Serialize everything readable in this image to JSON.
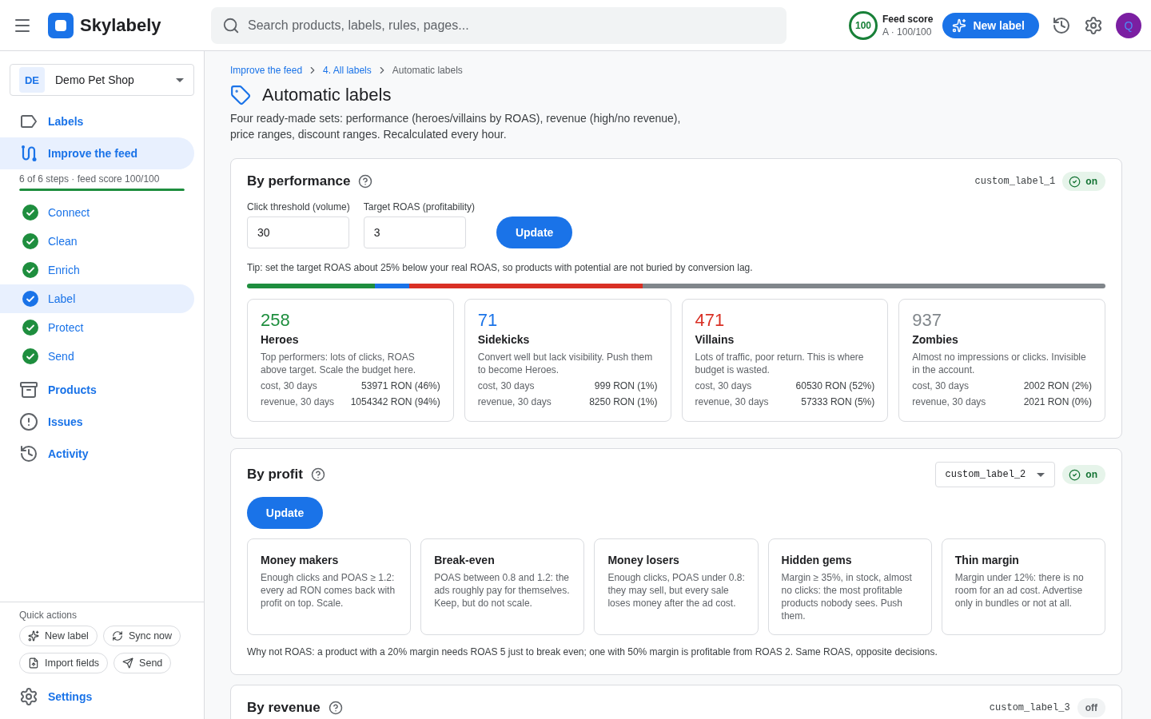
{
  "topbar": {
    "app_name": "Skylabely",
    "search": {
      "placeholder": "Search products, labels, rules, pages..."
    },
    "feed_score": {
      "value": "100",
      "title": "Feed score",
      "subtitle": "A · 100/100"
    },
    "new_label_button": "New label",
    "avatar": "Q"
  },
  "sidebar": {
    "account": {
      "initials": "DE",
      "name": "Demo Pet Shop"
    },
    "nav": [
      {
        "label": "Labels",
        "selected": false
      },
      {
        "label": "Improve the feed",
        "selected": true,
        "progress": {
          "text": "6 of 6 steps · feed score 100/100",
          "level": 1
        },
        "children": [
          {
            "label": "Connect",
            "done": true,
            "selected": false
          },
          {
            "label": "Clean",
            "done": true,
            "selected": false
          },
          {
            "label": "Enrich",
            "done": true,
            "selected": false
          },
          {
            "label": "Label",
            "done": true,
            "selected": true
          },
          {
            "label": "Protect",
            "done": true,
            "selected": false
          },
          {
            "label": "Send",
            "done": true,
            "selected": false
          }
        ]
      },
      {
        "label": "Products",
        "selected": false
      },
      {
        "label": "Issues",
        "selected": false
      },
      {
        "label": "Activity",
        "selected": false
      }
    ],
    "quick_actions": {
      "title": "Quick actions",
      "actions": [
        "New label",
        "Sync now",
        "Import fields",
        "Send"
      ]
    },
    "footer_link": {
      "label": "Settings",
      "selected": false
    }
  },
  "breadcrumbs": [
    {
      "label": "Improve the feed",
      "current": false
    },
    {
      "label": "4. All labels",
      "current": false
    },
    {
      "label": "Automatic labels",
      "current": true
    }
  ],
  "page": {
    "title": "Automatic labels",
    "description": "Four ready-made sets: performance (heroes/villains by ROAS), revenue (high/no revenue), price ranges, discount ranges. Recalculated every hour."
  },
  "sections": [
    {
      "kind": "performance",
      "title": "By performance",
      "field": {
        "kind": "text",
        "value": "custom_label_1"
      },
      "status": {
        "label": "on",
        "on": true
      },
      "inputs": [
        {
          "label": "Click threshold (volume)",
          "value": "30"
        },
        {
          "label": "Target ROAS (profitability)",
          "value": "3"
        }
      ],
      "button": "Update",
      "tip": "Tip: set the target ROAS about 25% below your real ROAS, so products with potential are not buried by conversion lag.",
      "groups": [
        {
          "count": "258",
          "name": "Heroes",
          "color": "#1e8e3e",
          "description": "Top performers: lots of clicks, ROAS above target. Scale the budget here.",
          "metrics": [
            {
              "label": "cost, 30 days",
              "value": "53971 RON (46%)"
            },
            {
              "label": "revenue, 30 days",
              "value": "1054342 RON (94%)"
            }
          ]
        },
        {
          "count": "71",
          "name": "Sidekicks",
          "color": "#1a73e8",
          "description": "Convert well but lack visibility. Push them to become Heroes.",
          "metrics": [
            {
              "label": "cost, 30 days",
              "value": "999 RON (1%)"
            },
            {
              "label": "revenue, 30 days",
              "value": "8250 RON (1%)"
            }
          ]
        },
        {
          "count": "471",
          "name": "Villains",
          "color": "#d93025",
          "description": "Lots of traffic, poor return. This is where budget is wasted.",
          "metrics": [
            {
              "label": "cost, 30 days",
              "value": "60530 RON (52%)"
            },
            {
              "label": "revenue, 30 days",
              "value": "57333 RON (5%)"
            }
          ]
        },
        {
          "count": "937",
          "name": "Zombies",
          "color": "#80868b",
          "description": "Almost no impressions or clicks. Invisible in the account.",
          "metrics": [
            {
              "label": "cost, 30 days",
              "value": "2002 RON (2%)"
            },
            {
              "label": "revenue, 30 days",
              "value": "2021 RON (0%)"
            }
          ]
        }
      ]
    },
    {
      "kind": "profit",
      "title": "By profit",
      "field": {
        "kind": "select",
        "value": "custom_label_2"
      },
      "status": {
        "label": "on",
        "on": true
      },
      "button": "Update",
      "groups": [
        {
          "name": "Money makers",
          "description": "Enough clicks and POAS ≥ 1.2: every ad RON comes back with profit on top. Scale."
        },
        {
          "name": "Break-even",
          "description": "POAS between 0.8 and 1.2: the ads roughly pay for themselves. Keep, but do not scale."
        },
        {
          "name": "Money losers",
          "description": "Enough clicks, POAS under 0.8: they may sell, but every sale loses money after the ad cost."
        },
        {
          "name": "Hidden gems",
          "description": "Margin ≥ 35%, in stock, almost no clicks: the most profitable products nobody sees. Push them."
        },
        {
          "name": "Thin margin",
          "description": "Margin under 12%: there is no room for an ad cost. Advertise only in bundles or not at all."
        }
      ],
      "note": "Why not ROAS: a product with a 20% margin needs ROAS 5 just to break even; one with 50% margin is profitable from ROAS 2. Same ROAS, opposite decisions."
    },
    {
      "kind": "revenue",
      "title": "By revenue",
      "field": {
        "kind": "text",
        "value": "custom_label_3"
      },
      "status": {
        "label": "off",
        "on": false
      }
    }
  ]
}
